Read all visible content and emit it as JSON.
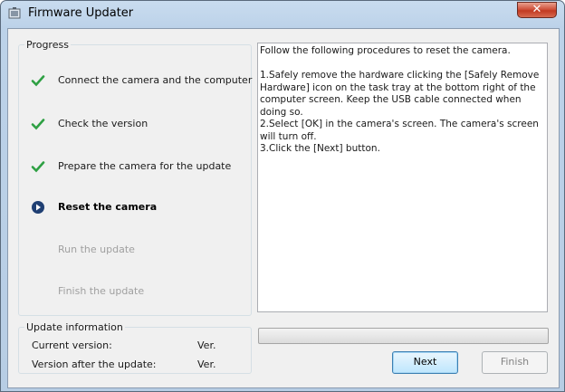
{
  "window": {
    "title": "Firmware Updater",
    "close_label": "✕"
  },
  "progress": {
    "legend": "Progress",
    "steps": [
      {
        "label": "Connect the camera and the computer",
        "state": "done",
        "icon": "check-icon"
      },
      {
        "label": "Check the version",
        "state": "done",
        "icon": "check-icon"
      },
      {
        "label": "Prepare the camera for the update",
        "state": "done",
        "icon": "check-icon"
      },
      {
        "label": "Reset the camera",
        "state": "current",
        "icon": "current-step-icon"
      },
      {
        "label": "Run the update",
        "state": "pending",
        "icon": ""
      },
      {
        "label": "Finish the update",
        "state": "pending",
        "icon": ""
      }
    ]
  },
  "info": {
    "legend": "Update information",
    "current_version_label": "Current version:",
    "current_version_value": "Ver.",
    "after_version_label": "Version after the update:",
    "after_version_value": "Ver."
  },
  "instructions": {
    "intro": "Follow the following procedures to reset the camera.",
    "lines": [
      "1.Safely remove the hardware clicking the [Safely Remove Hardware] icon on the task tray at the bottom right of the computer screen. Keep the USB cable connected when doing so.",
      "2.Select [OK] in the camera's screen. The camera's screen will turn off.",
      "3.Click the [Next] button."
    ]
  },
  "update_progress": {
    "value": 0
  },
  "buttons": {
    "next_label": "Next",
    "finish_label": "Finish"
  },
  "colors": {
    "check": "#2ea043",
    "current": "#1f3f73"
  }
}
